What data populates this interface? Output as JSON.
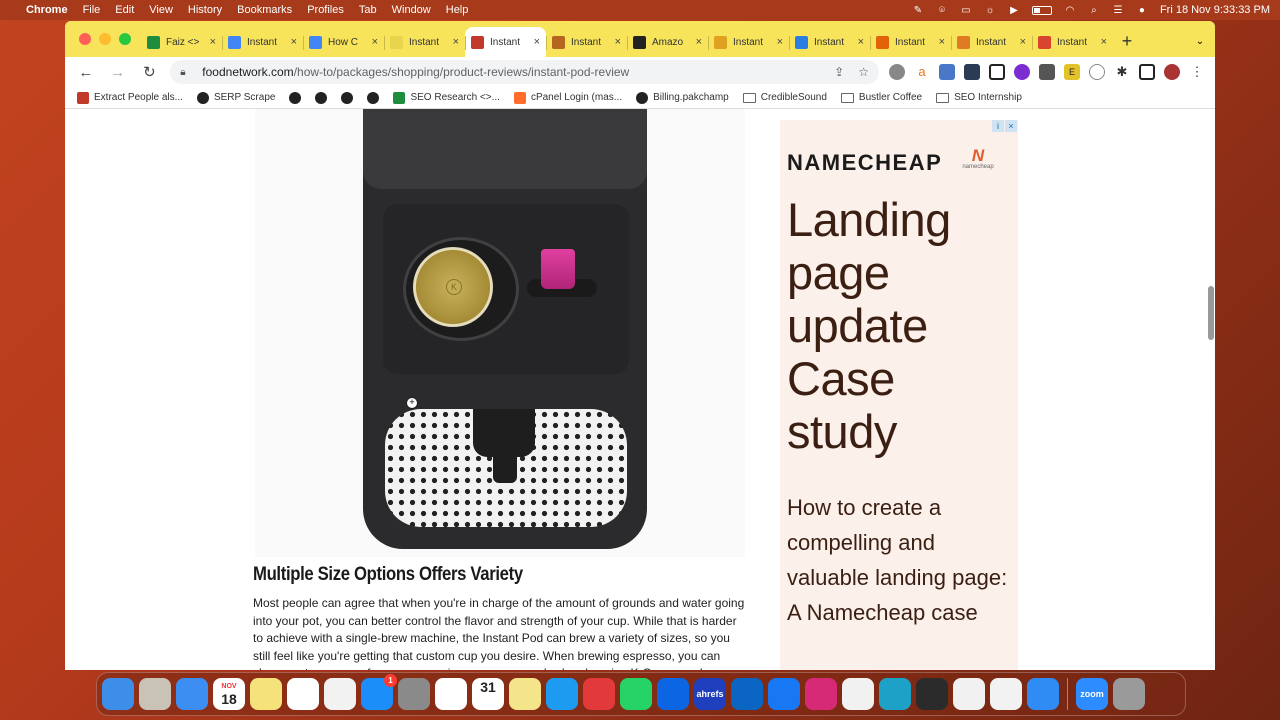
{
  "menubar": {
    "app": "Chrome",
    "menus": [
      "File",
      "Edit",
      "View",
      "History",
      "Bookmarks",
      "Profiles",
      "Tab",
      "Window",
      "Help"
    ],
    "clock": "Fri 18 Nov  9:33:33 PM"
  },
  "tabs": [
    {
      "label": "Faiz <>",
      "color": "#1e8e3e"
    },
    {
      "label": "Instant",
      "color": "#4285f4"
    },
    {
      "label": "How C",
      "color": "#4285f4"
    },
    {
      "label": "Instant",
      "color": "#e8d44d"
    },
    {
      "label": "Instant",
      "color": "#c0392b"
    },
    {
      "label": "Instant",
      "color": "#b5651d"
    },
    {
      "label": "Amazo",
      "color": "#222222"
    },
    {
      "label": "Instant",
      "color": "#e0a020"
    },
    {
      "label": "Instant",
      "color": "#2a7de1"
    },
    {
      "label": "Instant",
      "color": "#e36209"
    },
    {
      "label": "Instant",
      "color": "#e07b24"
    },
    {
      "label": "Instant",
      "color": "#d9442e"
    }
  ],
  "address": {
    "host": "foodnetwork.com",
    "path": "/how-to/packages/shopping/product-reviews/instant-pod-review"
  },
  "bookmarks": [
    {
      "label": "Extract People als...",
      "type": "icon",
      "color": "#c0392b"
    },
    {
      "label": "SERP Scrape",
      "type": "globe"
    },
    {
      "label": "",
      "type": "globe"
    },
    {
      "label": "",
      "type": "globe"
    },
    {
      "label": "",
      "type": "globe"
    },
    {
      "label": "",
      "type": "globe"
    },
    {
      "label": "SEO Research <>...",
      "type": "icon",
      "color": "#1e8e3e"
    },
    {
      "label": "cPanel Login (mas...",
      "type": "icon",
      "color": "#ff6c2c"
    },
    {
      "label": "Billing.pakchamp",
      "type": "globe"
    },
    {
      "label": "CredibleSound",
      "type": "folder"
    },
    {
      "label": "Bustler Coffee",
      "type": "folder"
    },
    {
      "label": "SEO Internship",
      "type": "folder"
    }
  ],
  "article": {
    "heading": "Multiple Size Options Offers Variety",
    "body": "Most people can agree that when you're in charge of the amount of grounds and water going into your pot, you can better control the flavor and strength of your cup. While that is harder to achieve with a single-brew machine, the Instant Pod can brew a variety of sizes, so you still feel like you're getting that custom cup you desire. When brewing espresso, you can choose a two-ounce, four-ounce or six-ounce pour, and, when brewing K-Cups, you have"
  },
  "ad": {
    "brand": "NAMECHEAP",
    "logo_text": "namecheap",
    "headline": "Landing page update Case study",
    "body": "How to create a compelling and valuable landing page: A Namecheap case"
  },
  "dock": {
    "apps": [
      {
        "name": "Finder",
        "color": "#3c8ee8"
      },
      {
        "name": "Launchpad",
        "color": "#c9c2b6"
      },
      {
        "name": "Mail",
        "color": "#3d8ef2"
      },
      {
        "name": "Calendar",
        "color": "#ffffff",
        "month": "NOV",
        "day": "18"
      },
      {
        "name": "Notes",
        "color": "#f6e27a"
      },
      {
        "name": "Reminders",
        "color": "#ffffff"
      },
      {
        "name": "Photos",
        "color": "#f2f2f2"
      },
      {
        "name": "App Store",
        "color": "#1c8ef9",
        "badge": "1"
      },
      {
        "name": "System Preferences",
        "color": "#8a8a8a"
      },
      {
        "name": "Slack",
        "color": "#ffffff"
      },
      {
        "name": "Google Calendar",
        "color": "#ffffff",
        "day": "31"
      },
      {
        "name": "Stickies",
        "color": "#f5e58a"
      },
      {
        "name": "Twitter",
        "color": "#1d9bf0"
      },
      {
        "name": "WPS",
        "color": "#e23a3a"
      },
      {
        "name": "WhatsApp",
        "color": "#25d366"
      },
      {
        "name": "Trello",
        "color": "#0c66e4"
      },
      {
        "name": "ahrefs",
        "color": "#1f3fbf",
        "text": "ahrefs"
      },
      {
        "name": "LinkedIn",
        "color": "#0a66c2"
      },
      {
        "name": "Facebook",
        "color": "#1877f2"
      },
      {
        "name": "Instagram",
        "color": "#d62976"
      },
      {
        "name": "Google Drive",
        "color": "#f1f1f1"
      },
      {
        "name": "Edge",
        "color": "#1da1c7"
      },
      {
        "name": "Lizard",
        "color": "#2b2b2b"
      },
      {
        "name": "Chrome",
        "color": "#f1f1f1"
      },
      {
        "name": "TextEdit",
        "color": "#f2f2f2"
      },
      {
        "name": "Safari",
        "color": "#2f8cf5"
      },
      {
        "name": "Zoom",
        "color": "#2d8cff",
        "text": "zoom"
      },
      {
        "name": "Trash",
        "color": "#9a9a9a"
      }
    ]
  }
}
